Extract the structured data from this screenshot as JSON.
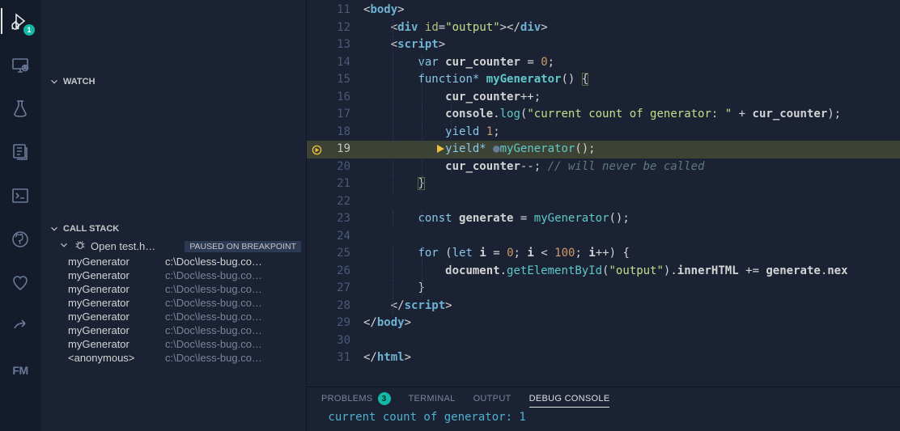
{
  "activity": {
    "run_badge": "1"
  },
  "sidebar": {
    "watch_label": "WATCH",
    "callstack_label": "CALL STACK",
    "thread_name": "Open test.h…",
    "paused_label": "PAUSED ON BREAKPOINT",
    "frames": [
      {
        "fn": "myGenerator",
        "path": "c:\\Doc\\less-bug.co…"
      },
      {
        "fn": "myGenerator",
        "path": "c:\\Doc\\less-bug.co…"
      },
      {
        "fn": "myGenerator",
        "path": "c:\\Doc\\less-bug.co…"
      },
      {
        "fn": "myGenerator",
        "path": "c:\\Doc\\less-bug.co…"
      },
      {
        "fn": "myGenerator",
        "path": "c:\\Doc\\less-bug.co…"
      },
      {
        "fn": "myGenerator",
        "path": "c:\\Doc\\less-bug.co…"
      },
      {
        "fn": "myGenerator",
        "path": "c:\\Doc\\less-bug.co…"
      },
      {
        "fn": "<anonymous>",
        "path": "c:\\Doc\\less-bug.co…"
      }
    ]
  },
  "editor": {
    "first_line": 11,
    "current_line": 19,
    "lines_count": 21
  },
  "panel": {
    "tabs": {
      "problems": "PROBLEMS",
      "problems_badge": "3",
      "terminal": "TERMINAL",
      "output": "OUTPUT",
      "debug_console": "DEBUG CONSOLE"
    },
    "debug_output": " current count of generator: 1"
  }
}
